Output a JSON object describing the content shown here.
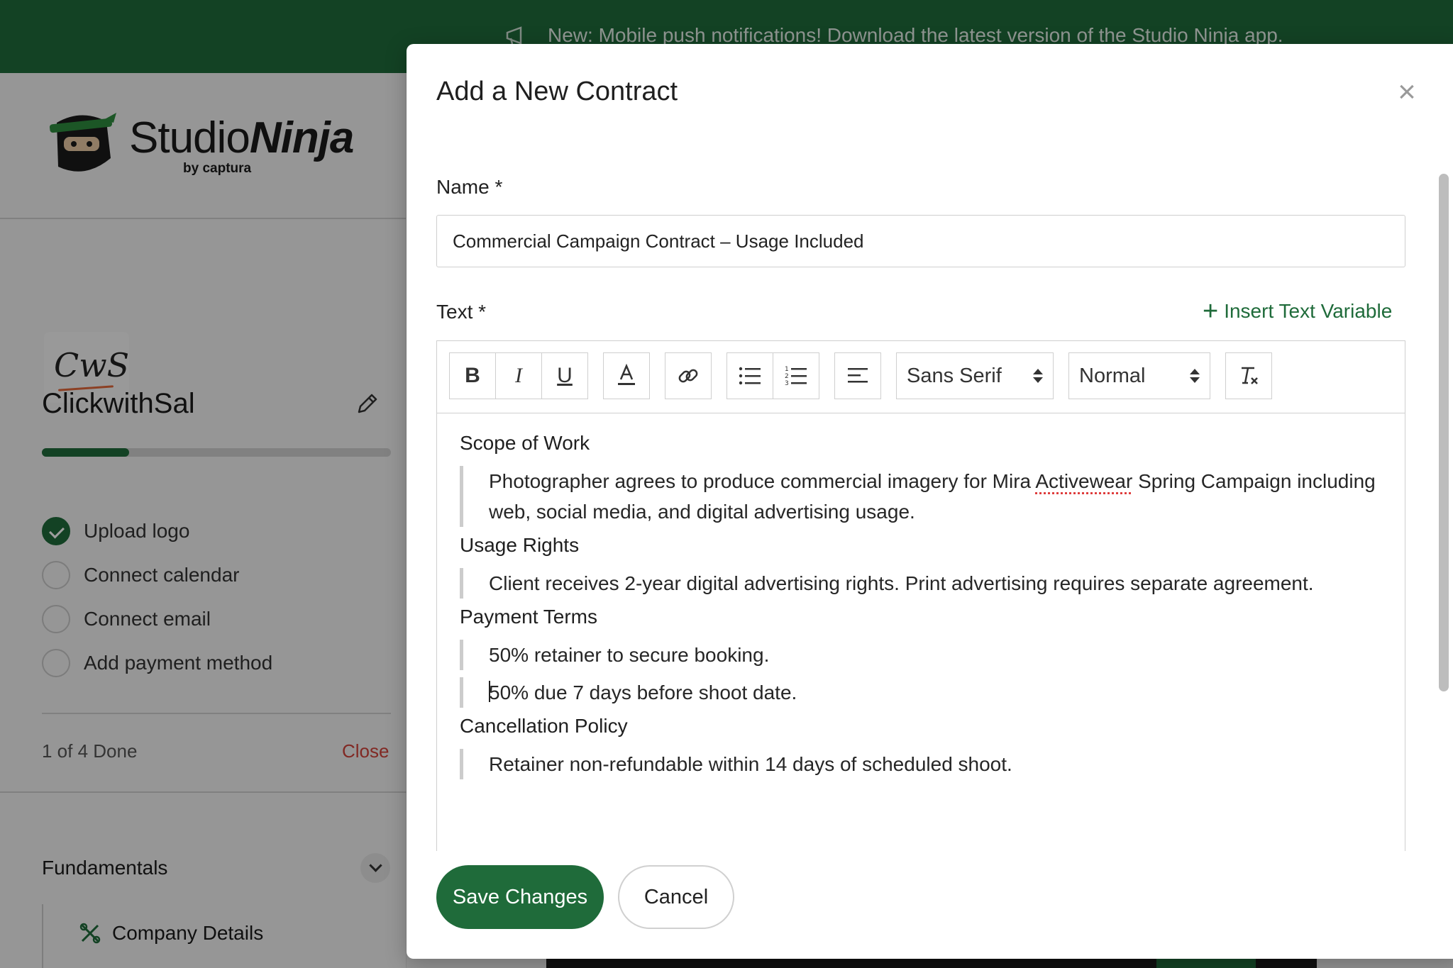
{
  "banner": {
    "text": "New: Mobile push notifications! Download the latest version of the Studio Ninja app."
  },
  "logo": {
    "word_regular": "Studio",
    "word_bold": "Ninja",
    "by_text": "by captura"
  },
  "company": {
    "logo_text": "CwS",
    "name": "ClickwithSal"
  },
  "onboarding": {
    "progress_percent": 25,
    "items": [
      {
        "label": "Upload logo",
        "done": true
      },
      {
        "label": "Connect calendar",
        "done": false
      },
      {
        "label": "Connect email",
        "done": false
      },
      {
        "label": "Add payment method",
        "done": false
      }
    ],
    "done_count": "1 of 4 Done",
    "close_label": "Close"
  },
  "nav": {
    "section": "Fundamentals",
    "item": "Company Details"
  },
  "modal": {
    "title": "Add a New Contract",
    "close_glyph": "×",
    "name_label": "Name *",
    "name_value": "Commercial Campaign Contract – Usage Included",
    "text_label": "Text *",
    "insert_variable": "Insert Text Variable",
    "toolbar": {
      "bold": "B",
      "italic": "I",
      "underline": "U",
      "font_family": "Sans Serif",
      "font_size": "Normal"
    },
    "content": {
      "scope_title": "Scope of Work",
      "scope_1": "Photographer agrees to produce commercial imagery for Mira ",
      "scope_spell": "Activewear",
      "scope_2": " Spring Campaign including web, social media, and digital advertising usage.",
      "usage_title": "Usage Rights",
      "usage_text": "Client receives 2-year digital advertising rights. Print advertising requires separate agreement.",
      "payment_title": "Payment Terms",
      "payment_1": "50% retainer to secure booking.",
      "payment_2": "50% due 7 days before shoot date.",
      "cancel_title": "Cancellation Policy",
      "cancel_text": "Retainer non-refundable within 14 days of scheduled shoot."
    },
    "save_label": "Save Changes",
    "cancel_label": "Cancel"
  },
  "colors": {
    "brand_green": "#1f6b3a",
    "danger_red": "#d0433a"
  }
}
